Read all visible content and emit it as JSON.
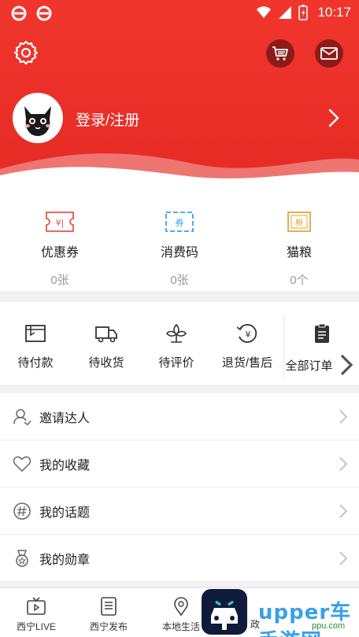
{
  "status_bar": {
    "time": "10:17"
  },
  "header": {
    "login_label": "登录/注册"
  },
  "assets": [
    {
      "icon": "coupon-icon",
      "label": "优惠券",
      "value": "0张",
      "color": "#e8534a"
    },
    {
      "icon": "voucher-code-icon",
      "label": "消费码",
      "value": "0张",
      "color": "#3aa0e8"
    },
    {
      "icon": "cat-food-icon",
      "label": "猫粮",
      "value": "0个",
      "color": "#e8a53a"
    }
  ],
  "orders": [
    {
      "icon": "wallet-icon",
      "label": "待付款"
    },
    {
      "icon": "truck-icon",
      "label": "待收货"
    },
    {
      "icon": "flower-icon",
      "label": "待评价"
    },
    {
      "icon": "refund-icon",
      "label": "退货/售后"
    },
    {
      "icon": "clipboard-icon",
      "label": "全部订单"
    }
  ],
  "menu": [
    {
      "icon": "person-invite-icon",
      "label": "邀请达人"
    },
    {
      "icon": "heart-icon",
      "label": "我的收藏"
    },
    {
      "icon": "hashtag-icon",
      "label": "我的话题"
    },
    {
      "icon": "medal-icon",
      "label": "我的勋章"
    }
  ],
  "bottom_nav": [
    {
      "icon": "tv-icon",
      "label": "西宁LIVE"
    },
    {
      "icon": "document-icon",
      "label": "西宁发布"
    },
    {
      "icon": "location-icon",
      "label": "本地生活"
    }
  ],
  "bottom_nav_partial": "政",
  "watermark": {
    "text": "upper车手游网",
    "sub": "ppu.com"
  },
  "colors": {
    "header_red": "#ea2f27",
    "accent_blue": "#3aa0e8"
  }
}
